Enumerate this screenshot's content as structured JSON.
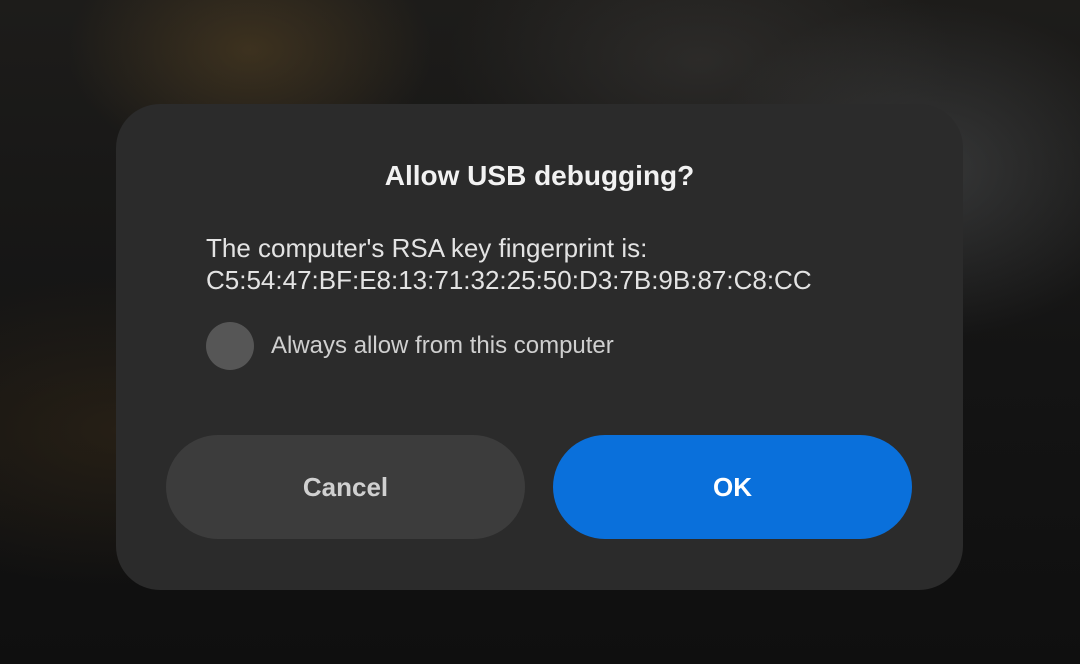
{
  "dialog": {
    "title": "Allow USB debugging?",
    "message_line1": "The computer's RSA key fingerprint is:",
    "message_line2": "C5:54:47:BF:E8:13:71:32:25:50:D3:7B:9B:87:C8:CC",
    "checkbox_label": "Always allow from this computer",
    "checkbox_checked": false,
    "cancel_label": "Cancel",
    "ok_label": "OK"
  },
  "colors": {
    "dialog_background": "#2b2b2b",
    "ok_button": "#0a70db",
    "cancel_button": "#3c3c3c",
    "checkbox_unchecked": "#565656"
  }
}
